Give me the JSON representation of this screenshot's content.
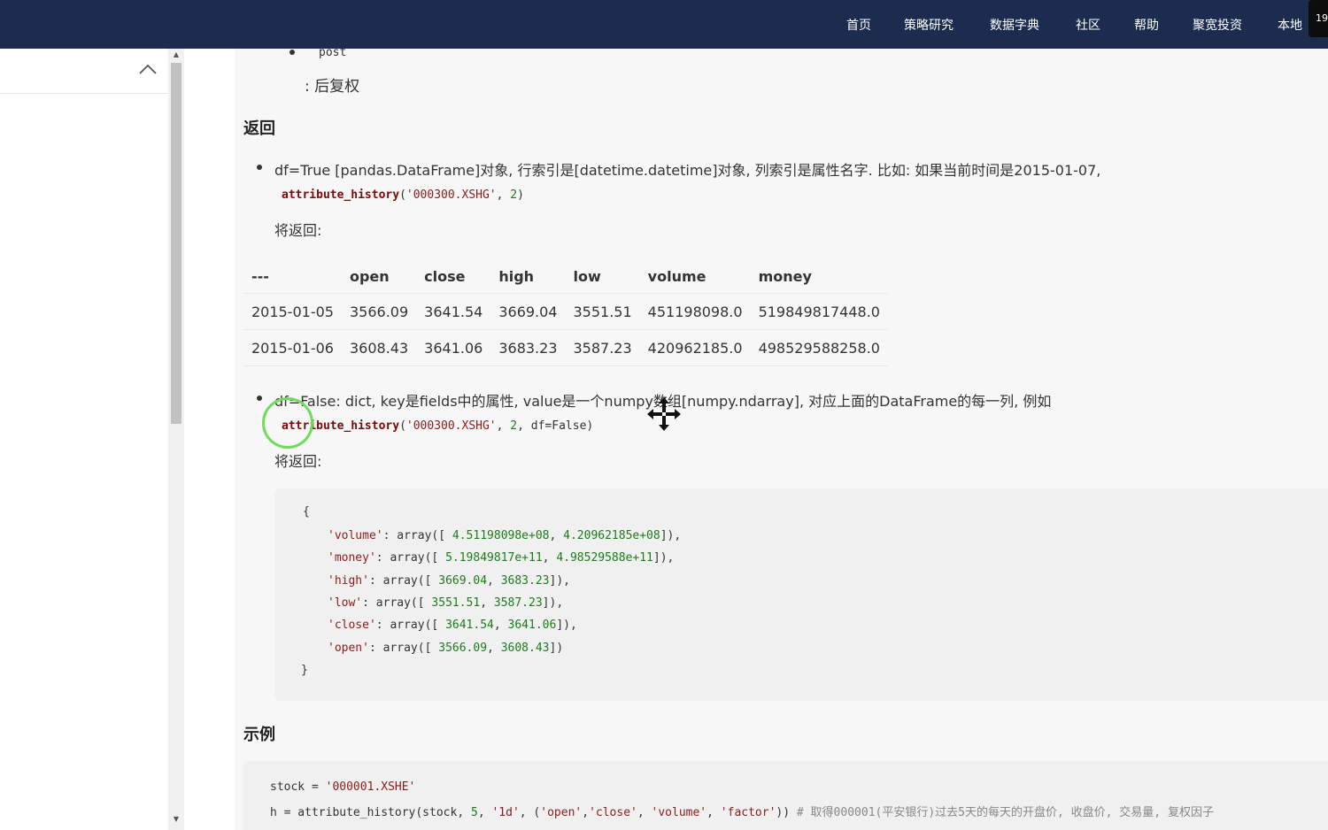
{
  "nav": {
    "items": [
      "首页",
      "策略研究",
      "数据字典",
      "社区",
      "帮助",
      "聚宽投资",
      "本地"
    ],
    "corner": "19"
  },
  "doc": {
    "post_item": "post",
    "post_desc": ": 后复权",
    "returns_heading": "返回",
    "df_true_text": "df=True [pandas.DataFrame]对象, 行索引是[datetime.datetime]对象, 列索引是属性名字. 比如: 如果当前时间是2015-01-07,",
    "call1": {
      "fn": "attribute_history",
      "open": "(",
      "arg1": "'000300.XSHG'",
      "sep": ", ",
      "arg2": "2",
      "close": ")"
    },
    "will_return_1": "将返回:",
    "table": {
      "headers": [
        "---",
        "open",
        "close",
        "high",
        "low",
        "volume",
        "money"
      ],
      "rows": [
        [
          "2015-01-05",
          "3566.09",
          "3641.54",
          "3669.04",
          "3551.51",
          "451198098.0",
          "519849817448.0"
        ],
        [
          "2015-01-06",
          "3608.43",
          "3641.06",
          "3683.23",
          "3587.23",
          "420962185.0",
          "498529588258.0"
        ]
      ]
    },
    "df_false_text": "df=False: dict, key是fields中的属性, value是一个numpy数组[numpy.ndarray], 对应上面的DataFrame的每一列, 例如",
    "call2": {
      "fn": "attribute_history",
      "open": "(",
      "arg1": "'000300.XSHG'",
      "sep": ", ",
      "arg2": "2",
      "rest": ", df=False)"
    },
    "will_return_2": "将返回:",
    "dict_block": {
      "open_brace": "{",
      "lines": [
        {
          "key": "'volume'",
          "mid": ": array([  ",
          "v1": "4.51198098e+08",
          "sep": ",   ",
          "v2": "4.20962185e+08",
          "end": "]),"
        },
        {
          "key": "'money'",
          "mid": ": array([  ",
          "v1": "5.19849817e+11",
          "sep": ",   ",
          "v2": "4.98529588e+11",
          "end": "]),"
        },
        {
          "key": "'high'",
          "mid": ": array([ ",
          "v1": "3669.04",
          "sep": ",  ",
          "v2": "3683.23",
          "end": "]),"
        },
        {
          "key": "'low'",
          "mid": ": array([ ",
          "v1": "3551.51",
          "sep": ",  ",
          "v2": "3587.23",
          "end": "]),"
        },
        {
          "key": "'close'",
          "mid": ": array([ ",
          "v1": "3641.54",
          "sep": ",  ",
          "v2": "3641.06",
          "end": "]),"
        },
        {
          "key": "'open'",
          "mid": ": array([ ",
          "v1": "3566.09",
          "sep": ",  ",
          "v2": "3608.43",
          "end": "])"
        }
      ],
      "close_brace": "}"
    },
    "example_heading": "示例",
    "example": {
      "line1_a": "stock = ",
      "line1_b": "'000001.XSHE'",
      "line2_a": "h = attribute_history(stock, ",
      "line2_num": "5",
      "line2_b": ", ",
      "line2_s1": "'1d'",
      "line2_c": ", (",
      "line2_s2": "'open'",
      "line2_d": ",",
      "line2_s3": "'close'",
      "line2_e": ", ",
      "line2_s4": "'volume'",
      "line2_f": ", ",
      "line2_s5": "'factor'",
      "line2_g": ")) ",
      "line2_comment": "# 取得000001(平安银行)过去5天的每天的开盘价, 收盘价, 交易量, 复权因子"
    }
  }
}
